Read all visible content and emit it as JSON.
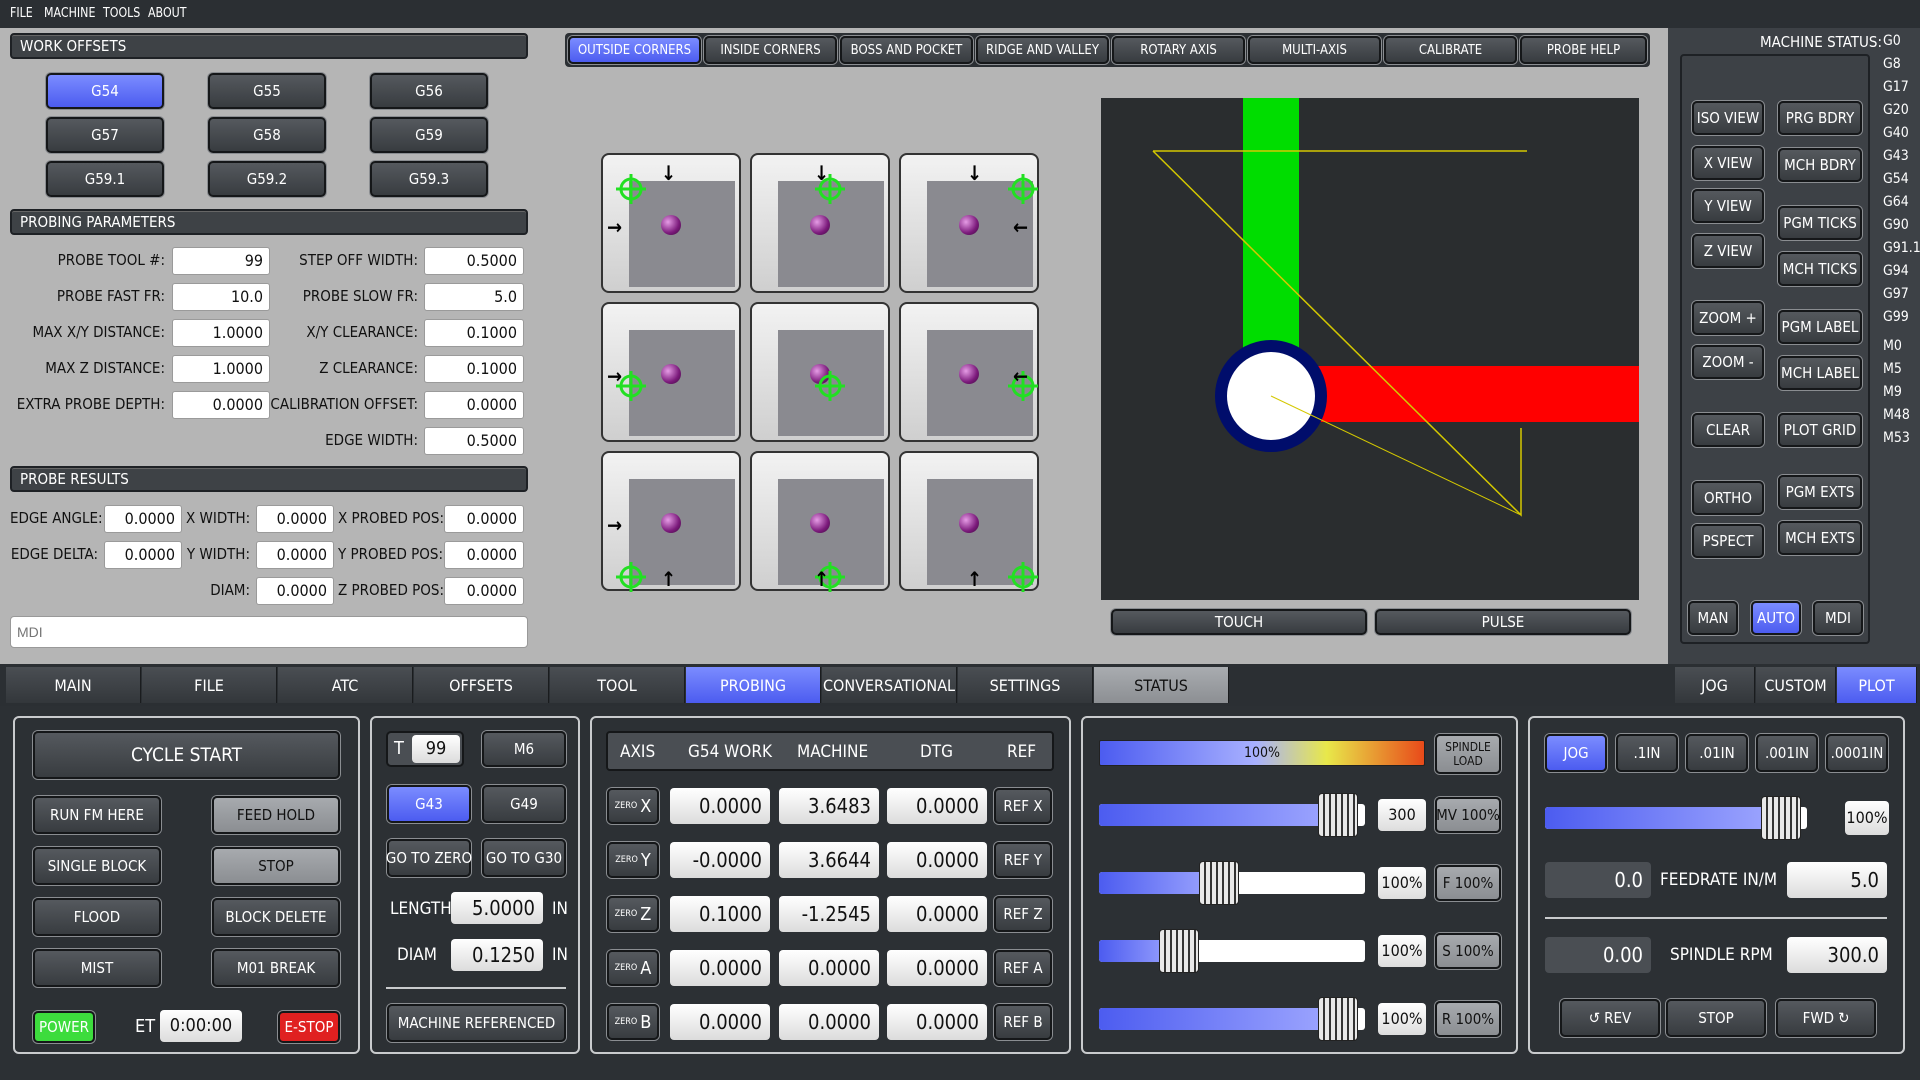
{
  "menu": [
    "FILE",
    "MACHINE",
    "TOOLS",
    "ABOUT"
  ],
  "work_offsets": {
    "header": "WORK OFFSETS",
    "buttons": [
      "G54",
      "G55",
      "G56",
      "G57",
      "G58",
      "G59",
      "G59.1",
      "G59.2",
      "G59.3"
    ],
    "active": "G54"
  },
  "probing_parameters": {
    "header": "PROBING PARAMETERS",
    "probe_tool_label": "PROBE TOOL #:",
    "probe_tool": "99",
    "step_off_label": "STEP OFF WIDTH:",
    "step_off": "0.5000",
    "fast_fr_label": "PROBE FAST FR:",
    "fast_fr": "10.0",
    "slow_fr_label": "PROBE SLOW FR:",
    "slow_fr": "5.0",
    "max_xy_label": "MAX X/Y DISTANCE:",
    "max_xy": "1.0000",
    "xy_clear_label": "X/Y CLEARANCE:",
    "xy_clear": "0.1000",
    "max_z_label": "MAX Z DISTANCE:",
    "max_z": "1.0000",
    "z_clear_label": "Z CLEARANCE:",
    "z_clear": "0.1000",
    "extra_depth_label": "EXTRA PROBE DEPTH:",
    "extra_depth": "0.0000",
    "cal_offset_label": "CALIBRATION OFFSET:",
    "cal_offset": "0.0000",
    "edge_width_label": "EDGE WIDTH:",
    "edge_width": "0.5000"
  },
  "probe_results": {
    "header": "PROBE RESULTS",
    "edge_angle_label": "EDGE ANGLE:",
    "edge_angle": "0.0000",
    "x_width_label": "X WIDTH:",
    "x_width": "0.0000",
    "x_probed_label": "X PROBED POS:",
    "x_probed": "0.0000",
    "edge_delta_label": "EDGE DELTA:",
    "edge_delta": "0.0000",
    "y_width_label": "Y WIDTH:",
    "y_width": "0.0000",
    "y_probed_label": "Y PROBED POS:",
    "y_probed": "0.0000",
    "diam_label": "DIAM:",
    "diam": "0.0000",
    "z_probed_label": "Z PROBED POS:",
    "z_probed": "0.0000"
  },
  "mdi_placeholder": "MDI",
  "probe_tabs": [
    "OUTSIDE CORNERS",
    "INSIDE CORNERS",
    "BOSS AND POCKET",
    "RIDGE AND VALLEY",
    "ROTARY AXIS",
    "MULTI-AXIS",
    "CALIBRATE",
    "PROBE HELP"
  ],
  "probe_tab_active": "OUTSIDE CORNERS",
  "touch_label": "TOUCH",
  "pulse_label": "PULSE",
  "machine_status": {
    "label": "MACHINE STATUS:",
    "codes": [
      "G0",
      "G8",
      "G17",
      "G20",
      "G40",
      "G43",
      "G54",
      "G64",
      "G90",
      "G91.1",
      "G94",
      "G97",
      "G99",
      "M0",
      "M5",
      "M9",
      "M48",
      "M53"
    ]
  },
  "view_buttons": {
    "iso": "ISO VIEW",
    "prg_bdry": "PRG BDRY",
    "x": "X VIEW",
    "mch_bdry": "MCH BDRY",
    "y": "Y VIEW",
    "pgm_ticks": "PGM TICKS",
    "z": "Z VIEW",
    "mch_ticks": "MCH TICKS",
    "zoom_in": "ZOOM +",
    "pgm_label": "PGM LABEL",
    "zoom_out": "ZOOM -",
    "mch_label": "MCH LABEL",
    "clear": "CLEAR",
    "plot_grid": "PLOT GRID",
    "ortho": "ORTHO",
    "pgm_exts": "PGM EXTS",
    "pspect": "PSPECT",
    "mch_exts": "MCH EXTS",
    "man": "MAN",
    "auto": "AUTO",
    "mdi": "MDI"
  },
  "main_tabs": [
    "MAIN",
    "FILE",
    "ATC",
    "OFFSETS",
    "TOOL",
    "PROBING",
    "CONVERSATIONAL",
    "SETTINGS",
    "STATUS"
  ],
  "main_tab_active": "PROBING",
  "right_tabs": [
    "JOG",
    "CUSTOM",
    "PLOT"
  ],
  "right_tab_active": "PLOT",
  "cycle": {
    "cycle_start": "CYCLE START",
    "run_fm_here": "RUN FM HERE",
    "feed_hold": "FEED HOLD",
    "single_block": "SINGLE BLOCK",
    "stop": "STOP",
    "flood": "FLOOD",
    "block_delete": "BLOCK DELETE",
    "mist": "MIST",
    "m01_break": "M01 BREAK",
    "power": "POWER",
    "et_label": "ET",
    "et_value": "0:00:00",
    "estop": "E-STOP"
  },
  "tool": {
    "t_label": "T",
    "t_value": "99",
    "m6": "M6",
    "g43": "G43",
    "g49": "G49",
    "go_to_zero": "GO TO ZERO",
    "go_to_g30": "GO TO G30",
    "length_label": "LENGTH",
    "length": "5.0000",
    "length_unit": "IN",
    "diam_label": "DIAM",
    "diam": "0.1250",
    "diam_unit": "IN",
    "machine_referenced": "MACHINE REFERENCED"
  },
  "dro": {
    "headers": [
      "AXIS",
      "G54 WORK",
      "MACHINE",
      "DTG",
      "REF"
    ],
    "zero_prefix": "ZERO",
    "rows": [
      {
        "axis": "X",
        "work": "0.0000",
        "machine": "3.6483",
        "dtg": "0.0000",
        "ref": "REF X"
      },
      {
        "axis": "Y",
        "work": "-0.0000",
        "machine": "3.6644",
        "dtg": "0.0000",
        "ref": "REF Y"
      },
      {
        "axis": "Z",
        "work": "0.1000",
        "machine": "-1.2545",
        "dtg": "0.0000",
        "ref": "REF Z"
      },
      {
        "axis": "A",
        "work": "0.0000",
        "machine": "0.0000",
        "dtg": "0.0000",
        "ref": "REF A"
      },
      {
        "axis": "B",
        "work": "0.0000",
        "machine": "0.0000",
        "dtg": "0.0000",
        "ref": "REF B"
      }
    ]
  },
  "overrides": {
    "spindle_load": "100%",
    "spindle_load_label": "SPINDLE LOAD",
    "mv_value": "300",
    "mv_btn": "MV 100%",
    "mv_level": 0.9,
    "f_value": "100%",
    "f_btn": "F 100%",
    "f_level": 0.45,
    "s_value": "100%",
    "s_btn": "S 100%",
    "s_level": 0.3,
    "r_value": "100%",
    "r_btn": "R 100%",
    "r_level": 0.9
  },
  "jog": {
    "jog": "JOG",
    "inc1": ".1IN",
    "inc2": ".01IN",
    "inc3": ".001IN",
    "inc4": ".0001IN",
    "jog_pct": "100%",
    "jog_level": 0.9,
    "feed_actual": "0.0",
    "feed_label": "FEEDRATE IN/M",
    "feed_set": "5.0",
    "rpm_actual": "0.00",
    "rpm_label": "SPINDLE RPM",
    "rpm_set": "300.0",
    "rev": "REV",
    "stop": "STOP",
    "fwd": "FWD"
  },
  "colors": {
    "accent": "#5b6cf5",
    "power": "#3ddc3d",
    "estop": "#e02020",
    "x_axis": "#ff0000",
    "y_axis": "#00dd00"
  }
}
